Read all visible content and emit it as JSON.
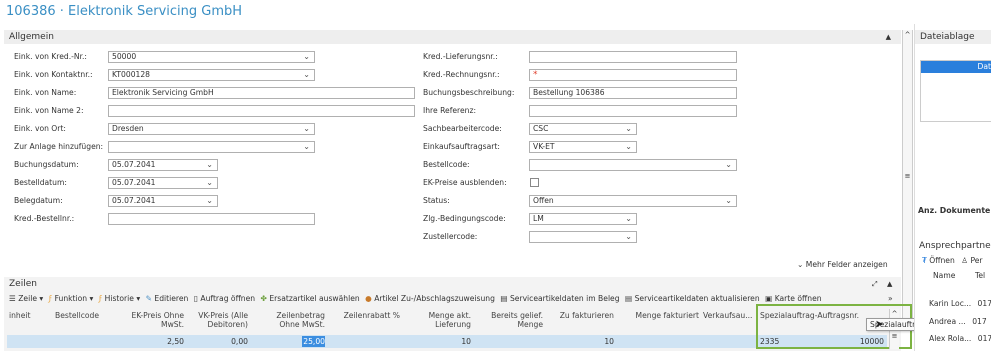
{
  "page_title": "106386 · Elektronik Servicing GmbH",
  "general": {
    "header": "Allgemein",
    "left_fields": [
      {
        "label": "Eink. von Kred.-Nr.:",
        "value": "50000",
        "type": "dropdown"
      },
      {
        "label": "Eink. von Kontaktnr.:",
        "value": "KT000128",
        "type": "dropdown"
      },
      {
        "label": "Eink. von Name:",
        "value": "Elektronik Servicing GmbH",
        "type": "text"
      },
      {
        "label": "Eink. von Name 2:",
        "value": "",
        "type": "text"
      },
      {
        "label": "Eink. von Ort:",
        "value": "Dresden",
        "type": "dropdown"
      },
      {
        "label": "Zur Anlage hinzufügen:",
        "value": "",
        "type": "dropdown"
      },
      {
        "label": "Buchungsdatum:",
        "value": "05.07.2041",
        "type": "date"
      },
      {
        "label": "Bestelldatum:",
        "value": "05.07.2041",
        "type": "date"
      },
      {
        "label": "Belegdatum:",
        "value": "05.07.2041",
        "type": "date"
      },
      {
        "label": "Kred.-Bestellnr.:",
        "value": "",
        "type": "text"
      }
    ],
    "right_fields": [
      {
        "label": "Kred.-Lieferungsnr.:",
        "value": ""
      },
      {
        "label": "Kred.-Rechnungsnr.:",
        "value": "*"
      },
      {
        "label": "Buchungsbeschreibung:",
        "value": "Bestellung 106386"
      },
      {
        "label": "Ihre Referenz:",
        "value": ""
      },
      {
        "label": "Sachbearbeitercode:",
        "value": "CSC"
      },
      {
        "label": "Einkaufsauftragsart:",
        "value": "VK-ET"
      },
      {
        "label": "Bestellcode:",
        "value": ""
      },
      {
        "label": "EK-Preise ausblenden:",
        "value": ""
      },
      {
        "label": "Status:",
        "value": "Offen"
      },
      {
        "label": "Zlg.-Bedingungscode:",
        "value": "LM"
      },
      {
        "label": "Zustellercode:",
        "value": ""
      }
    ],
    "more_fields": "Mehr Felder anzeigen"
  },
  "lines": {
    "header": "Zeilen",
    "toolbar": [
      "Zeile",
      "Funktion",
      "Historie",
      "Editieren",
      "Auftrag öffnen",
      "Ersatzartikel auswählen",
      "Artikel Zu-/Abschlagszuweisung",
      "Serviceartikeldaten im Beleg",
      "Serviceartikeldaten aktualisieren",
      "Karte öffnen"
    ],
    "columns": [
      {
        "l1": "inheit",
        "l2": ""
      },
      {
        "l1": "Bestellcode",
        "l2": ""
      },
      {
        "l1": "EK-Preis Ohne",
        "l2": "MwSt."
      },
      {
        "l1": "VK-Preis (Alle",
        "l2": "Debitoren)"
      },
      {
        "l1": "Zeilenbetrag",
        "l2": "Ohne MwSt."
      },
      {
        "l1": "Zeilenrabatt %",
        "l2": ""
      },
      {
        "l1": "Menge akt.",
        "l2": "Lieferung"
      },
      {
        "l1": "Bereits gelief.",
        "l2": "Menge"
      },
      {
        "l1": "Zu fakturieren",
        "l2": ""
      },
      {
        "l1": "Menge fakturiert",
        "l2": ""
      },
      {
        "l1": "Verkaufsau...",
        "l2": ""
      },
      {
        "l1": "Spezialauftrag-Auftragsnr.",
        "l2": ""
      }
    ],
    "row": {
      "ek_preis": "2,50",
      "vk_preis": "0,00",
      "zeilenbetrag": "25,00",
      "menge_akt": "10",
      "zu_fakturieren": "10",
      "spezial_nr": "2335",
      "spezial_zeile": "10000"
    },
    "tooltip": "Spezialauftrag-Verk.-Zeilennr."
  },
  "side": {
    "dateiablage": "Dateiablage",
    "dateiablage_item": "Dat",
    "anz_dokumente": "Anz. Dokumente",
    "ansprechpartner": "Ansprechpartne",
    "open": "Öffnen",
    "per": "Per",
    "col_name": "Name",
    "col_tel": "Tel",
    "contacts": [
      {
        "name": "Karin Loc...",
        "tel": "017"
      },
      {
        "name": "Andrea ...",
        "tel": "017"
      },
      {
        "name": "Alex Rola...",
        "tel": "017"
      }
    ]
  }
}
